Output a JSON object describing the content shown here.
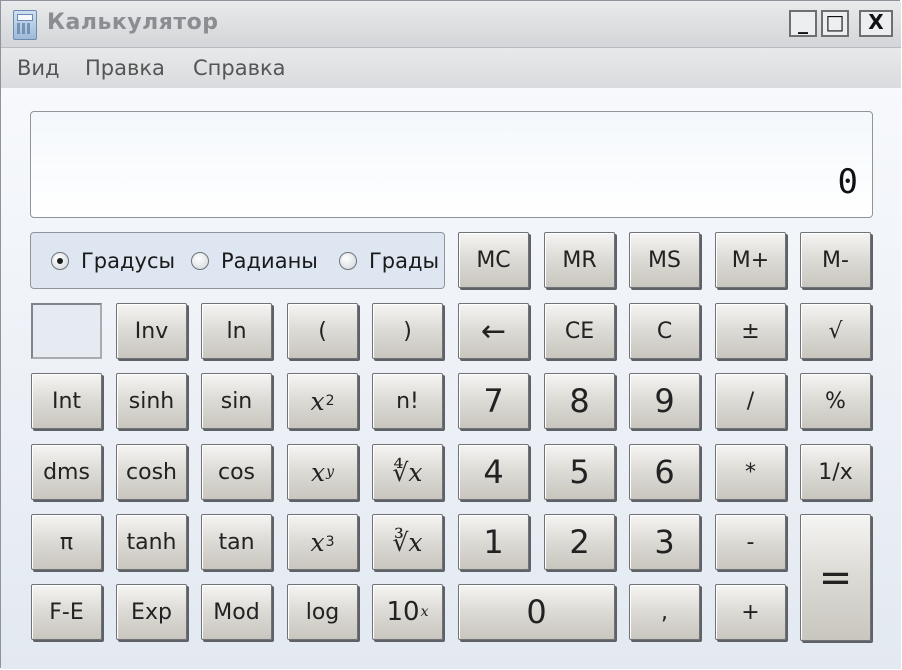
{
  "window": {
    "title": "Калькулятор"
  },
  "window_controls": {
    "minimize": "_",
    "maximize": "□",
    "close": "X"
  },
  "menu": [
    "Вид",
    "Правка",
    "Справка"
  ],
  "display": {
    "value": "0"
  },
  "angle_units": [
    {
      "label": "Градусы",
      "checked": true
    },
    {
      "label": "Радианы",
      "checked": false
    },
    {
      "label": "Грады",
      "checked": false
    }
  ],
  "buttons": {
    "mc": "MC",
    "mr": "MR",
    "ms": "MS",
    "m_plus": "M+",
    "m_minus": "M-",
    "inv": "Inv",
    "ln": "ln",
    "lparen": "(",
    "rparen": ")",
    "backspace": "←",
    "ce": "CE",
    "c": "C",
    "plus_minus": "±",
    "sqrt": "√",
    "int": "Int",
    "sinh": "sinh",
    "sin": "sin",
    "x_sq": "x",
    "x_sq_exp": "2",
    "fact": "n!",
    "seven": "7",
    "eight": "8",
    "nine": "9",
    "div": "/",
    "percent": "%",
    "dms": "dms",
    "cosh": "cosh",
    "cos": "cos",
    "x_y": "x",
    "x_y_exp": "y",
    "y_root": "∜x",
    "four": "4",
    "five": "5",
    "six": "6",
    "mul": "*",
    "reciprocal": "1/x",
    "pi": "π",
    "tanh": "tanh",
    "tan": "tan",
    "x_cube": "x",
    "x_cube_exp": "3",
    "cube_root": "∛x",
    "one": "1",
    "two": "2",
    "three": "3",
    "minus": "-",
    "equals": "=",
    "fe": "F-E",
    "exp": "Exp",
    "mod": "Mod",
    "log": "log",
    "ten_pow": "10",
    "ten_pow_exp": "x",
    "zero": "0",
    "decimal": ",",
    "plus": "+"
  }
}
